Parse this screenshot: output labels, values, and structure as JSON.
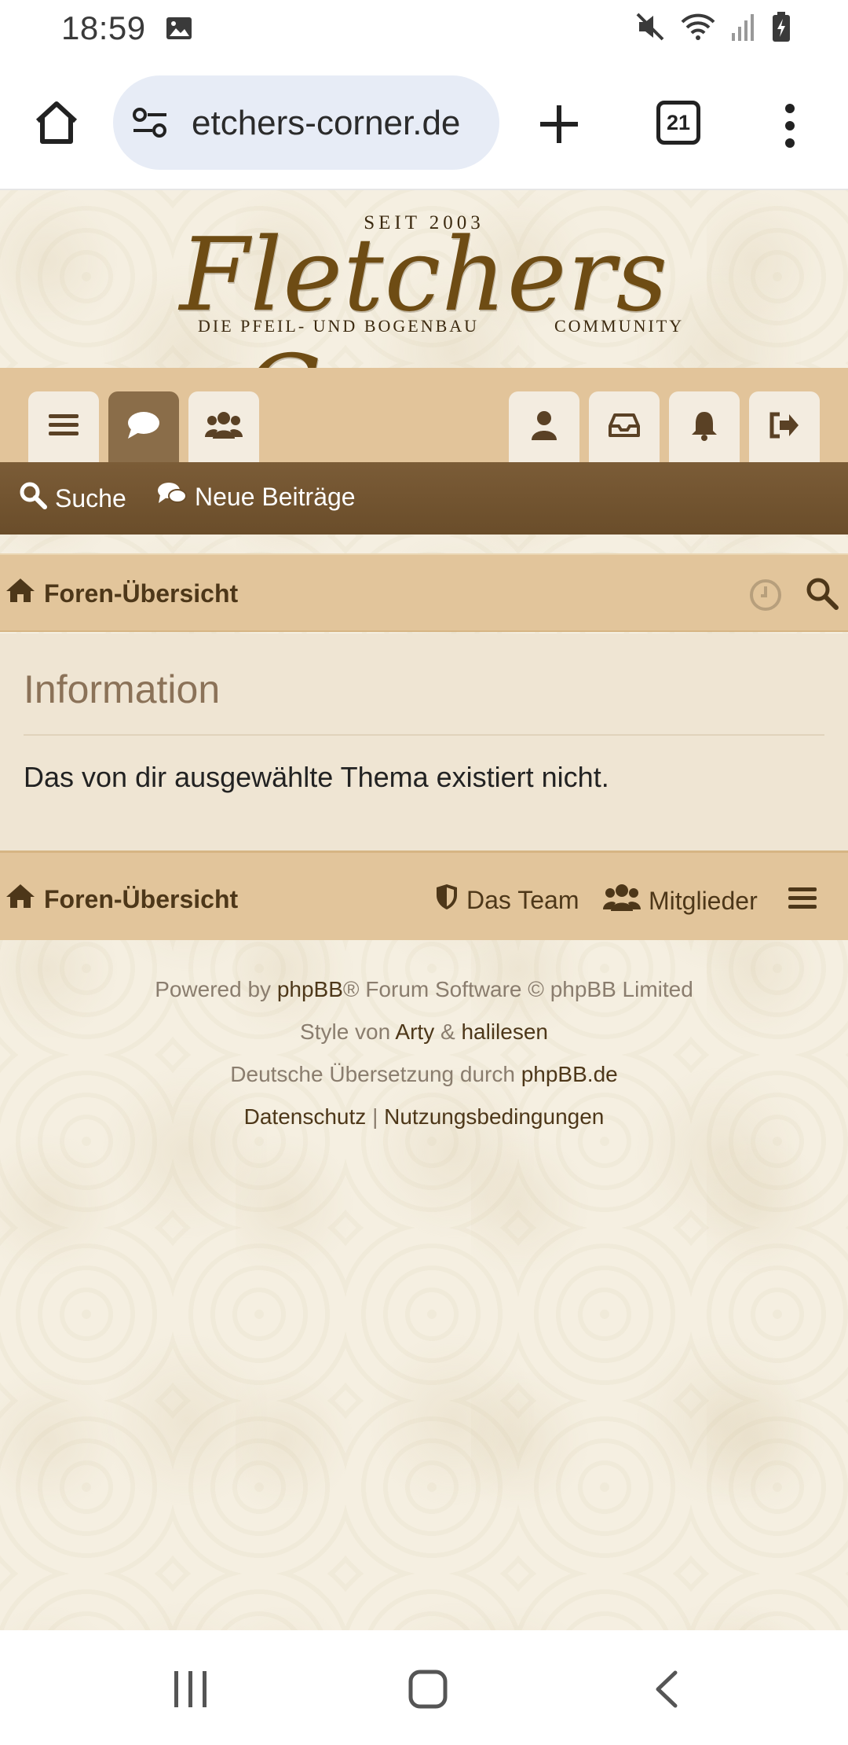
{
  "status_bar": {
    "time": "18:59"
  },
  "browser": {
    "url": "etchers-corner.de",
    "tab_count": "21"
  },
  "site": {
    "logo_seit": "SEIT 2003",
    "logo_title": "Fletchers Corner",
    "logo_sub_left": "DIE PFEIL- UND BOGENBAU",
    "logo_sub_right": "COMMUNITY"
  },
  "nav": {
    "search_label": "Suche",
    "new_posts_label": "Neue Beiträge"
  },
  "breadcrumb": {
    "label": "Foren-Übersicht"
  },
  "info": {
    "title": "Information",
    "message": "Das von dir ausgewählte Thema existiert nicht."
  },
  "footer": {
    "index_label": "Foren-Übersicht",
    "team_label": "Das Team",
    "members_label": "Mitglieder"
  },
  "credits": {
    "powered_by": "Powered by",
    "phpbb": "phpBB",
    "forum_software": "® Forum Software © phpBB Limited",
    "style_von": "Style von",
    "arty": "Arty",
    "amp": "&",
    "halilesen": "halilesen",
    "translation": "Deutsche Übersetzung durch",
    "phpbb_de": "phpBB.de",
    "privacy": "Datenschutz",
    "separator": "|",
    "terms": "Nutzungsbedingungen"
  },
  "colors": {
    "brand_brown": "#6a4d2a",
    "tan": "#e2c59b",
    "panel": "#efe5d3",
    "url_pill": "#e7ecf6"
  },
  "icons": [
    "image-icon",
    "mute-icon",
    "wifi-icon",
    "signal-icon",
    "battery-icon",
    "home-icon",
    "tune-icon",
    "plus-icon",
    "tabs-icon",
    "more-icon",
    "bars-icon",
    "comment-icon",
    "users-icon",
    "user-icon",
    "inbox-icon",
    "bell-icon",
    "logout-icon",
    "search-icon",
    "comments-icon",
    "clock-icon",
    "shield-icon",
    "recents-icon",
    "android-home-icon",
    "back-icon"
  ]
}
